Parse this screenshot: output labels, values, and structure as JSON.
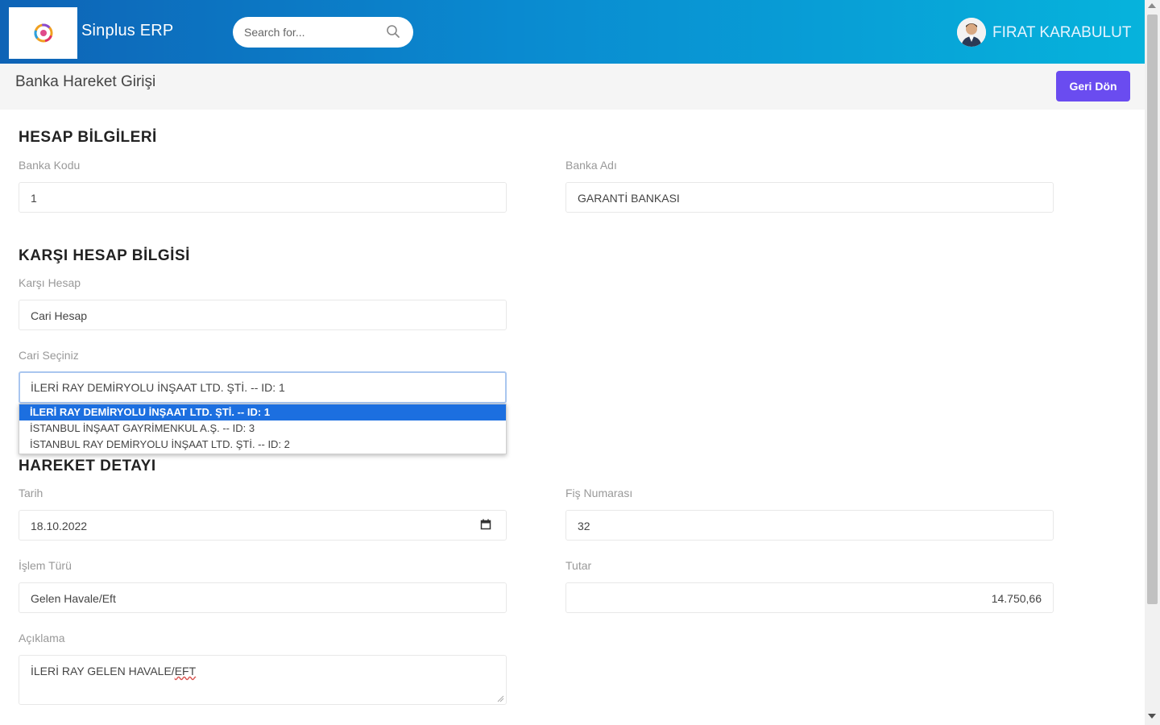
{
  "app": {
    "name": "Sinplus ERP"
  },
  "search": {
    "placeholder": "Search for..."
  },
  "user": {
    "name": "FIRAT KARABULUT"
  },
  "page": {
    "title": "Banka Hareket Girişi",
    "back_label": "Geri Dön"
  },
  "sections": {
    "account": "HESAP BİLGİLERİ",
    "counter": "KARŞI HESAP BİLGİSİ",
    "movement": "HAREKET DETAYI"
  },
  "fields": {
    "bank_code": {
      "label": "Banka Kodu",
      "value": "1"
    },
    "bank_name": {
      "label": "Banka Adı",
      "value": "GARANTİ BANKASI"
    },
    "counter_account": {
      "label": "Karşı Hesap",
      "value": "Cari Hesap"
    },
    "cari_select": {
      "label": "Cari Seçiniz",
      "value": "İLERİ RAY DEMİRYOLU İNŞAAT LTD. ŞTİ. -- ID: 1"
    },
    "date": {
      "label": "Tarih",
      "value": "18.10.2022"
    },
    "receipt_no": {
      "label": "Fiş Numarası",
      "value": "32"
    },
    "transaction_type": {
      "label": "İşlem Türü",
      "value": "Gelen Havale/Eft"
    },
    "amount": {
      "label": "Tutar",
      "value": "14.750,66"
    },
    "description": {
      "label": "Açıklama",
      "value_prefix": "İLERİ RAY GELEN HAVALE/",
      "value_suffix": "EFT"
    }
  },
  "dropdown_options": [
    "İLERİ RAY DEMİRYOLU İNŞAAT LTD. ŞTİ. -- ID: 1",
    "İSTANBUL İNŞAAT GAYRİMENKUL A.Ş. -- ID: 3",
    "İSTANBUL RAY DEMİRYOLU İNŞAAT LTD. ŞTİ. -- ID: 2"
  ],
  "colors": {
    "topbar_start": "#0e63b6",
    "topbar_end": "#06b3dc",
    "button": "#6a4cf0",
    "dropdown_selected": "#1c6fe0"
  }
}
